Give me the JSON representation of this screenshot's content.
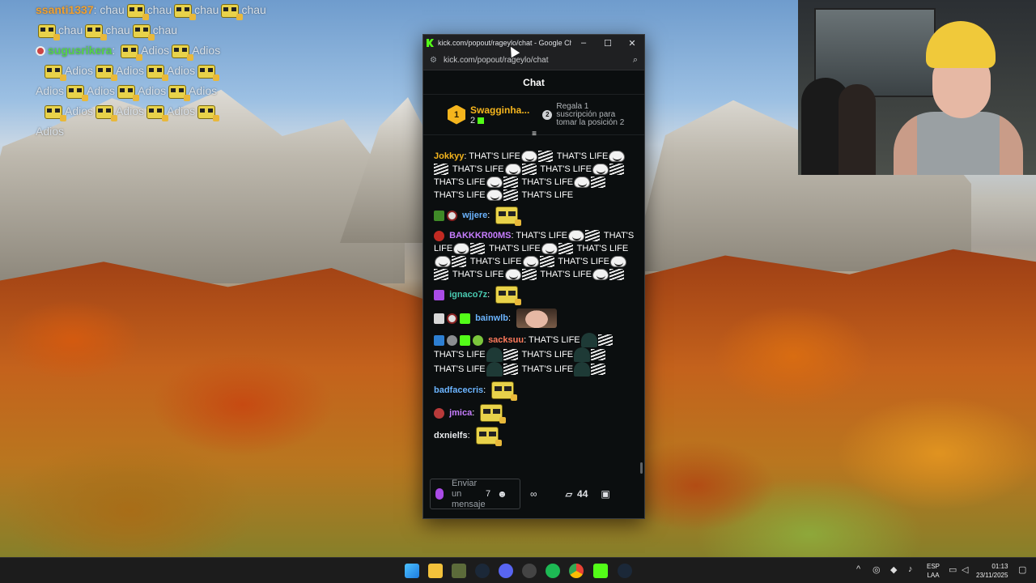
{
  "overlay_chat": {
    "line1_user": "ssanti1337",
    "line1_word": "chau",
    "line2_word": "chau",
    "line3_user": "sugusrikera",
    "adios_word": "Adios"
  },
  "browser": {
    "window_title": "kick.com/popout/rageylo/chat - Google Chro...",
    "url": "kick.com/popout/rageylo/chat",
    "minimize": "–",
    "maximize": "☐",
    "close": "✕"
  },
  "chat": {
    "header": "Chat",
    "pinned_gifter": {
      "rank": "1",
      "name": "Swagginha...",
      "count": "2",
      "next_rank": "2",
      "info": "Regala 1 suscripción para tomar la posición 2"
    },
    "messages": [
      {
        "user": "Jokkyy",
        "color": "#f5b51d",
        "text": "THAT'S LIFE"
      },
      {
        "user": "wjjere",
        "color": "#6bb4ff"
      },
      {
        "user": "BAKKKR00MS",
        "color": "#c77dff",
        "text": "THAT'S LIFE"
      },
      {
        "user": "ignaco7z",
        "color": "#49c9b0"
      },
      {
        "user": "bainwlb",
        "color": "#6bb4ff"
      },
      {
        "user": "sacksuu",
        "color": "#ff7a5c",
        "text": "THAT'S LIFE"
      },
      {
        "user": "badfacecris",
        "color": "#6bb4ff"
      },
      {
        "user": "jmica",
        "color": "#c77dff"
      },
      {
        "user": "dxnielfs",
        "color": "#e8eaed"
      }
    ],
    "input_placeholder": "Enviar un mensaje",
    "tickets_count": "44"
  },
  "taskbar": {
    "language": "ESP",
    "layout": "LAA",
    "time": "01:13",
    "date": "23/11/2025"
  }
}
